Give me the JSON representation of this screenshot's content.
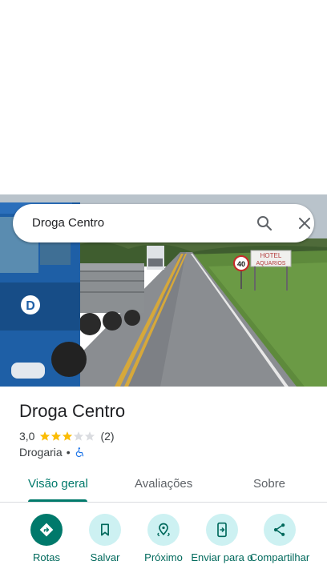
{
  "search": {
    "query": "Droga Centro"
  },
  "place": {
    "name": "Droga Centro",
    "rating": "3,0",
    "stars_filled": 3,
    "stars_total": 5,
    "review_count": "(2)",
    "category": "Drogaria",
    "separator": "•"
  },
  "photo": {
    "sign_text_line1": "HOTEL",
    "sign_text_line2": "AQUARIOS",
    "speed_limit": "40",
    "truck_badge": "D"
  },
  "tabs": [
    {
      "label": "Visão geral",
      "active": true
    },
    {
      "label": "Avaliações",
      "active": false
    },
    {
      "label": "Sobre",
      "active": false
    }
  ],
  "actions": [
    {
      "label": "Rotas",
      "icon": "directions-icon"
    },
    {
      "label": "Salvar",
      "icon": "bookmark-icon"
    },
    {
      "label": "Próximo",
      "icon": "nearby-icon"
    },
    {
      "label": "Enviar para o",
      "icon": "send-to-phone-icon"
    },
    {
      "label": "Compartilhar",
      "icon": "share-icon"
    }
  ],
  "colors": {
    "accent": "#00796b",
    "action_bg": "#cdf1f2",
    "star": "#fbbc04",
    "star_empty": "#dadce0"
  }
}
